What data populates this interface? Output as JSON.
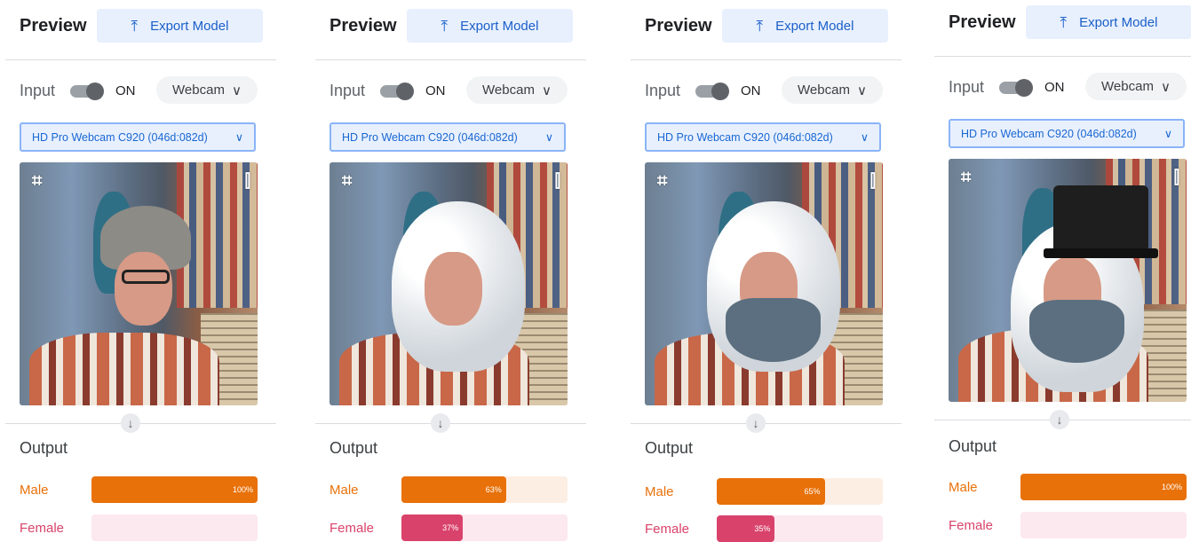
{
  "colors": {
    "male": "#e8710a",
    "male_track": "#fdeee3",
    "female": "#d9436b",
    "female_track": "#fce8ef"
  },
  "panels": [
    {
      "header": {
        "title": "Preview",
        "export_label": "Export Model"
      },
      "input": {
        "label": "Input",
        "toggle_state": "ON",
        "source": "Webcam"
      },
      "device": "HD Pro Webcam C920 (046d:082d)",
      "output": {
        "title": "Output",
        "classes": [
          {
            "label": "Male",
            "pct_text": "100%",
            "value": 1.0
          },
          {
            "label": "Female",
            "pct_text": "",
            "value": 0.0
          }
        ]
      }
    },
    {
      "header": {
        "title": "Preview",
        "export_label": "Export Model"
      },
      "input": {
        "label": "Input",
        "toggle_state": "ON",
        "source": "Webcam"
      },
      "device": "HD Pro Webcam C920 (046d:082d)",
      "output": {
        "title": "Output",
        "classes": [
          {
            "label": "Male",
            "pct_text": "63%",
            "value": 0.63
          },
          {
            "label": "Female",
            "pct_text": "37%",
            "value": 0.37
          }
        ]
      }
    },
    {
      "header": {
        "title": "Preview",
        "export_label": "Export Model"
      },
      "input": {
        "label": "Input",
        "toggle_state": "ON",
        "source": "Webcam"
      },
      "device": "HD Pro Webcam C920 (046d:082d)",
      "output": {
        "title": "Output",
        "classes": [
          {
            "label": "Male",
            "pct_text": "65%",
            "value": 0.65
          },
          {
            "label": "Female",
            "pct_text": "35%",
            "value": 0.35
          }
        ]
      }
    },
    {
      "header": {
        "title": "Preview",
        "export_label": "Export Model"
      },
      "input": {
        "label": "Input",
        "toggle_state": "ON",
        "source": "Webcam"
      },
      "device": "HD Pro Webcam C920 (046d:082d)",
      "output": {
        "title": "Output",
        "classes": [
          {
            "label": "Male",
            "pct_text": "100%",
            "value": 1.0
          },
          {
            "label": "Female",
            "pct_text": "",
            "value": 0.0
          }
        ]
      }
    }
  ]
}
